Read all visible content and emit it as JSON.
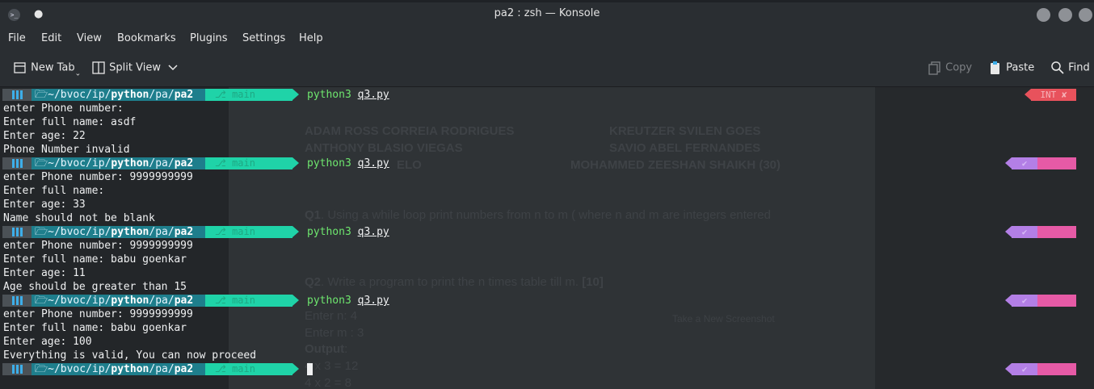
{
  "window": {
    "title": "pa2 : zsh — Konsole"
  },
  "menu": [
    "File",
    "Edit",
    "View",
    "Bookmarks",
    "Plugins",
    "Settings",
    "Help"
  ],
  "toolbar": {
    "new_tab": "New Tab",
    "split_view": "Split View",
    "copy": "Copy",
    "paste": "Paste",
    "find": "Find"
  },
  "prompt": {
    "path_prefix": "~/bvoc/ip/",
    "path_bold1": "python",
    "path_mid": "/pa/",
    "path_bold2": "pa2",
    "git": "main",
    "command": "python3",
    "arg": "q3.py",
    "status_int": "INT ✘",
    "status_ok": "✔"
  },
  "runs": [
    [
      "enter Phone number:",
      "Enter full name: asdf",
      "Enter age: 22",
      "Phone Number invalid"
    ],
    [
      "enter Phone number: 9999999999",
      "Enter full name:",
      "Enter age: 33",
      "Name should not be blank"
    ],
    [
      "enter Phone number: 9999999999",
      "Enter full name: babu goenkar",
      "Enter age: 11",
      "Age should be greater than 15"
    ],
    [
      "enter Phone number: 9999999999",
      "Enter full name: babu goenkar",
      "Enter age: 100",
      "Everything is valid, You can now proceed"
    ]
  ],
  "background_doc": {
    "names_left": [
      "ADAM ROSS CORREIA RODRIGUES",
      "ANTHONY BLASIO VIEGAS",
      "ELO"
    ],
    "names_right": [
      "KREUTZER SVILEN GOES",
      "SAVIO ABEL FERNANDES",
      "MOHAMMED ZEESHAN SHAIKH (30)"
    ],
    "q1_label": "Q1",
    "q1_text": ". Using a while loop print numbers from n to m ( where  n and m are integers entered",
    "q2_label": "Q2",
    "q2_text": ". Write a program to print the n times table till m. ",
    "q2_marks": "[10]",
    "lines": [
      "Enter n: 4",
      "Enter m : 3",
      "Output",
      ":",
      "4 x 3 = 12",
      "4 x 2 = 8"
    ],
    "faint_hint": "Take a New Screenshot"
  }
}
